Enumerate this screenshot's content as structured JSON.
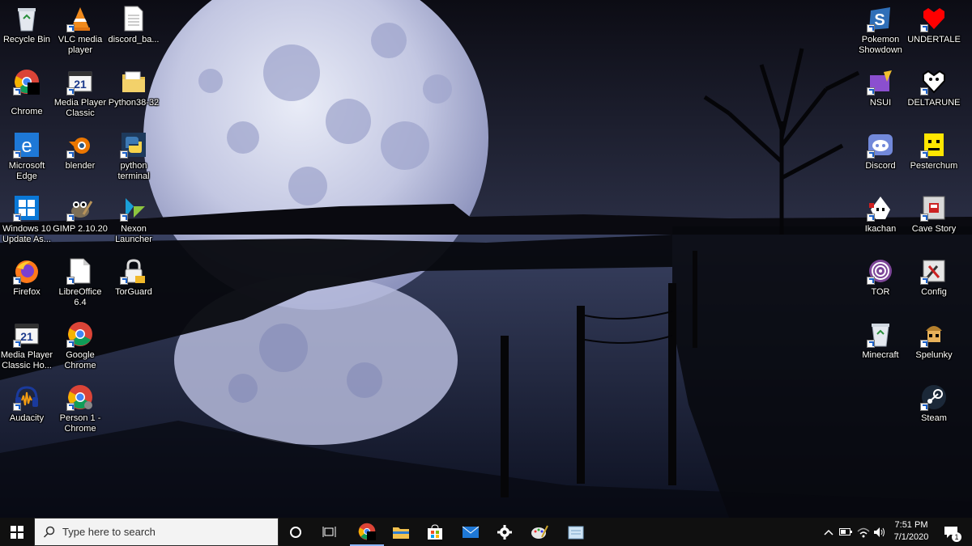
{
  "desktop": {
    "left_icons": [
      {
        "label": "Recycle Bin",
        "icon": "recycle-bin-icon"
      },
      {
        "label": "VLC media player",
        "icon": "vlc-icon"
      },
      {
        "label": "discord_ba...",
        "icon": "text-file-icon"
      },
      {
        "label": "Chrome",
        "icon": "chrome-icon"
      },
      {
        "label": "Media Player Classic",
        "icon": "media-player-classic-icon"
      },
      {
        "label": "Python38-32",
        "icon": "folder-icon"
      },
      {
        "label": "Microsoft Edge",
        "icon": "edge-icon"
      },
      {
        "label": "blender",
        "icon": "blender-icon"
      },
      {
        "label": "python terminal",
        "icon": "python-icon"
      },
      {
        "label": "Windows 10 Update As...",
        "icon": "windows-icon"
      },
      {
        "label": "GIMP 2.10.20",
        "icon": "gimp-icon"
      },
      {
        "label": "Nexon Launcher",
        "icon": "nexon-icon"
      },
      {
        "label": "Firefox",
        "icon": "firefox-icon"
      },
      {
        "label": "LibreOffice 6.4",
        "icon": "libreoffice-icon"
      },
      {
        "label": "TorGuard",
        "icon": "lock-icon"
      },
      {
        "label": "Media Player Classic Ho...",
        "icon": "media-player-classic-icon"
      },
      {
        "label": "Google Chrome",
        "icon": "chrome-icon"
      },
      {
        "label": "Audacity",
        "icon": "audacity-icon"
      },
      {
        "label": "Person 1 - Chrome",
        "icon": "chrome-icon"
      }
    ],
    "right_icons": [
      {
        "label": "Pokemon Showdown",
        "icon": "pokemon-showdown-icon"
      },
      {
        "label": "UNDERTALE",
        "icon": "heart-icon"
      },
      {
        "label": "NSUI",
        "icon": "nsui-icon"
      },
      {
        "label": "DELTARUNE",
        "icon": "deltarune-icon"
      },
      {
        "label": "Discord",
        "icon": "discord-icon"
      },
      {
        "label": "Pesterchum",
        "icon": "pesterchum-icon"
      },
      {
        "label": "Ikachan",
        "icon": "ikachan-icon"
      },
      {
        "label": "Cave Story",
        "icon": "cave-story-icon"
      },
      {
        "label": "TOR",
        "icon": "tor-icon"
      },
      {
        "label": "Config",
        "icon": "config-icon"
      },
      {
        "label": "Minecraft",
        "icon": "minecraft-icon"
      },
      {
        "label": "Spelunky",
        "icon": "spelunky-icon"
      },
      {
        "label": "Steam",
        "icon": "steam-icon"
      }
    ]
  },
  "taskbar": {
    "search_placeholder": "Type here to search",
    "pinned": [
      "cortana-icon",
      "task-view-icon",
      "chrome-icon",
      "file-explorer-icon",
      "store-icon",
      "mail-icon",
      "settings-icon",
      "paint-icon",
      "notepad-icon"
    ],
    "clock_time": "7:51 PM",
    "clock_date": "7/1/2020",
    "notification_count": "1"
  },
  "colors": {
    "taskbar_bg": "#101010",
    "sky_top": "#0b0d16",
    "water": "#1a2238",
    "moon": "#c9cde6"
  }
}
